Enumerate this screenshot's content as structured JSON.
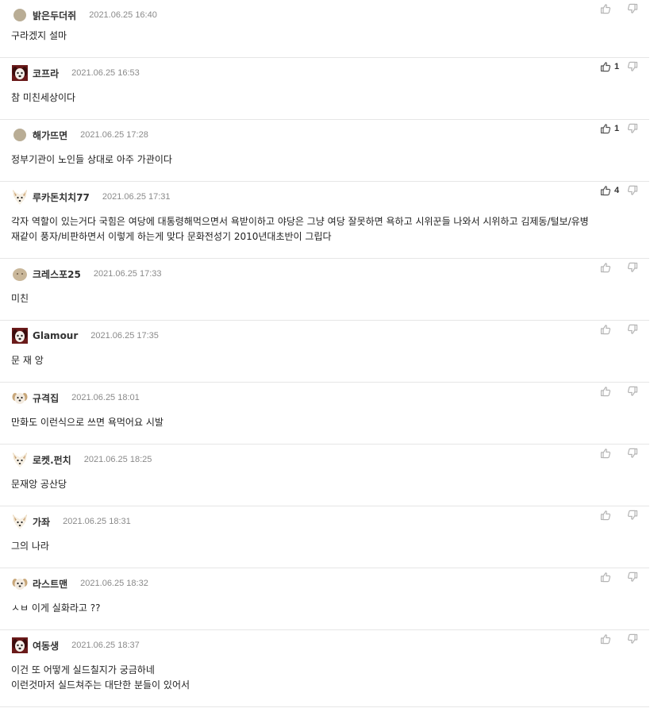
{
  "comments": [
    {
      "nick": "밝은두더쥐",
      "date": "2021.06.25 16:40",
      "text": [
        "구라겠지 설마"
      ],
      "up_count": "",
      "avatar": "plain-circle"
    },
    {
      "nick": "코프라",
      "date": "2021.06.25 16:53",
      "text": [
        "참 미친세상이다"
      ],
      "up_count": "1",
      "avatar": "dark-dog"
    },
    {
      "nick": "해가뜨면",
      "date": "2021.06.25 17:28",
      "text": [
        "정부기관이 노인들 상대로 아주 가관이다"
      ],
      "up_count": "1",
      "avatar": "plain-circle"
    },
    {
      "nick": "루카돈치치77",
      "date": "2021.06.25 17:31",
      "text": [
        "각자 역할이 있는거다 국힘은 여당에 대통령해먹으면서 욕받이하고 야당은 그냥 여당 잘못하면 욕하고 시위꾼들 나와서 시위하고 김제동/털보/유병",
        "재같이 풍자/비판하면서 이렇게 하는게 맞다 문화전성기 2010년대초반이 그립다"
      ],
      "up_count": "4",
      "avatar": "fox"
    },
    {
      "nick": "크레스포25",
      "date": "2021.06.25 17:33",
      "text": [
        "미친"
      ],
      "up_count": "",
      "avatar": "round-face"
    },
    {
      "nick": "Glamour",
      "date": "2021.06.25 17:35",
      "text": [
        "문 재 앙"
      ],
      "up_count": "",
      "avatar": "dark-dog"
    },
    {
      "nick": "규격집",
      "date": "2021.06.25 18:01",
      "text": [
        "만화도 이런식으로 쓰면 욕먹어요 시발"
      ],
      "up_count": "",
      "avatar": "light-dog"
    },
    {
      "nick": "로켓.펀치",
      "date": "2021.06.25 18:25",
      "text": [
        "문재앙 공산당"
      ],
      "up_count": "",
      "avatar": "fox"
    },
    {
      "nick": "가좌",
      "date": "2021.06.25 18:31",
      "text": [
        "그의 나라"
      ],
      "up_count": "",
      "avatar": "fox"
    },
    {
      "nick": "라스트맨",
      "date": "2021.06.25 18:32",
      "text": [
        "ㅅㅂ 이게 실화라고 ??"
      ],
      "up_count": "",
      "avatar": "light-dog"
    },
    {
      "nick": "여동생",
      "date": "2021.06.25 18:37",
      "text": [
        "이건 또 어떻게 실드칠지가 궁금하네",
        "이런것마저 실드쳐주는 대단한 분들이 있어서"
      ],
      "up_count": "",
      "avatar": "dark-dog"
    }
  ],
  "colors": {
    "divider": "#e6e6e6",
    "date": "#8a8a8a",
    "icon": "#b5b5b5",
    "icon_active": "#555555"
  }
}
